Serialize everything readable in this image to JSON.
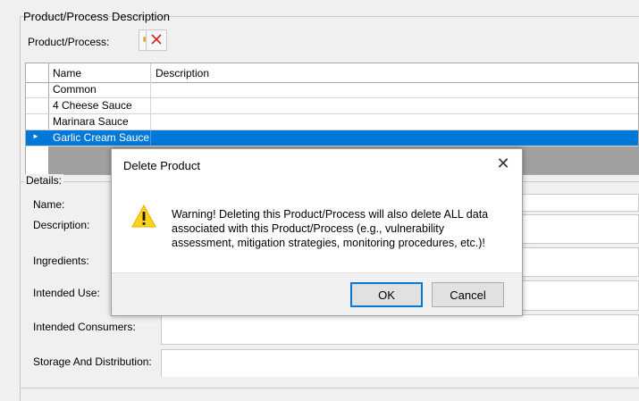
{
  "section": {
    "title": "Product/Process Description"
  },
  "toolbar": {
    "label": "Product/Process:",
    "add_icon": "plus-icon",
    "delete_icon": "delete-x-icon",
    "add_color": "#e8a000",
    "delete_color": "#e02020"
  },
  "grid": {
    "columns": [
      "Name",
      "Description"
    ],
    "rows": [
      {
        "name": "Common",
        "description": ""
      },
      {
        "name": "4 Cheese Sauce",
        "description": ""
      },
      {
        "name": "Marinara Sauce",
        "description": ""
      },
      {
        "name": "Garlic Cream Sauce",
        "description": ""
      }
    ],
    "selected_row": 3,
    "selection_color": "#0078d7"
  },
  "details": {
    "title": "Details:",
    "fields": {
      "name": "Name:",
      "description": "Description:",
      "ingredients": "Ingredients:",
      "intended_use": "Intended Use:",
      "intended_consumers": "Intended Consumers:",
      "storage": "Storage And Distribution:"
    }
  },
  "dialog": {
    "title": "Delete Product",
    "close_icon": "close-icon",
    "warning_icon": "warning-triangle-icon",
    "message": "Warning!  Deleting this Product/Process will also delete ALL data associated with this Product/Process (e.g., vulnerability assessment, mitigation strategies, monitoring procedures, etc.)!",
    "ok_label": "OK",
    "cancel_label": "Cancel"
  }
}
